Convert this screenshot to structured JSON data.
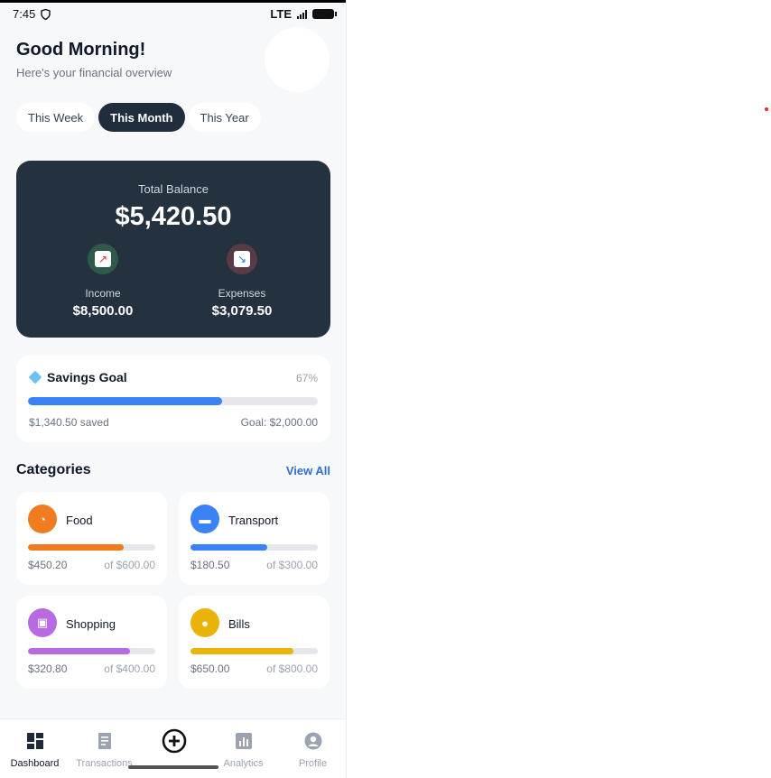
{
  "status_bar": {
    "time": "7:45",
    "network": "LTE"
  },
  "greeting": {
    "title": "Good Morning!",
    "subtitle": "Here's your financial overview"
  },
  "periods": [
    "This Week",
    "This Month",
    "This Year"
  ],
  "active_period": "This Month",
  "balance": {
    "label": "Total Balance",
    "amount": "$5,420.50",
    "income_label": "Income",
    "income_value": "$8,500.00",
    "expenses_label": "Expenses",
    "expenses_value": "$3,079.50"
  },
  "savings": {
    "title": "Savings Goal",
    "percent": "67%",
    "progress": 0.67,
    "saved": "$1,340.50 saved",
    "goal": "Goal: $2,000.00"
  },
  "categories": {
    "title": "Categories",
    "view_all": "View All",
    "items": [
      {
        "name": "Food",
        "spent": "$450.20",
        "limit": "of $600.00",
        "progress": 0.75,
        "color": "#f07c1f"
      },
      {
        "name": "Transport",
        "spent": "$180.50",
        "limit": "of $300.00",
        "progress": 0.6,
        "color": "#3b82f6"
      },
      {
        "name": "Shopping",
        "spent": "$320.80",
        "limit": "of $400.00",
        "progress": 0.8,
        "color": "#b86ae3"
      },
      {
        "name": "Bills",
        "spent": "$650.00",
        "limit": "of $800.00",
        "progress": 0.81,
        "color": "#eab308"
      }
    ]
  },
  "nav": {
    "dashboard": "Dashboard",
    "transactions": "Transactions",
    "analytics": "Analytics",
    "profile": "Profile"
  },
  "colors": {
    "dark": "#243240",
    "accent": "#2f6fd0",
    "savings_bar": "#3b82f6"
  },
  "icons": {
    "income": "trend-up-icon",
    "expenses": "trend-down-icon",
    "savings": "gem-icon",
    "food": "pizza-icon",
    "transport": "car-icon",
    "shopping": "shopping-bag-icon",
    "bills": "lightbulb-icon",
    "dashboard": "grid-icon",
    "transactions": "receipt-icon",
    "add": "plus-circle-icon",
    "analytics": "bar-chart-icon",
    "profile": "user-icon"
  }
}
